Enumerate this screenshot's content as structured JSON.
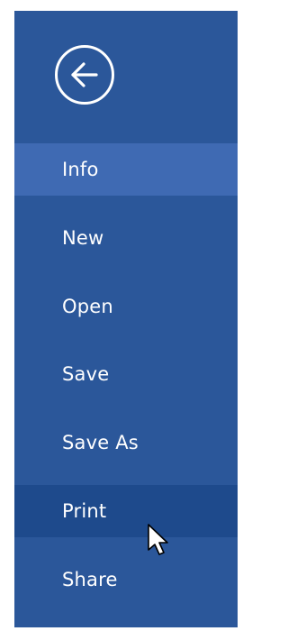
{
  "backstage": {
    "back_icon": "back-arrow-circle-icon",
    "items": [
      {
        "label": "Info",
        "state": "selected"
      },
      {
        "label": "New",
        "state": "normal"
      },
      {
        "label": "Open",
        "state": "normal"
      },
      {
        "label": "Save",
        "state": "normal"
      },
      {
        "label": "Save As",
        "state": "normal"
      },
      {
        "label": "Print",
        "state": "hover"
      },
      {
        "label": "Share",
        "state": "normal"
      }
    ]
  },
  "colors": {
    "nav_background": "#2b579a",
    "selected_background": "#3f6ab3",
    "hover_background": "#1e4a8c",
    "text": "#ffffff"
  },
  "cursor": "mouse-pointer-icon"
}
